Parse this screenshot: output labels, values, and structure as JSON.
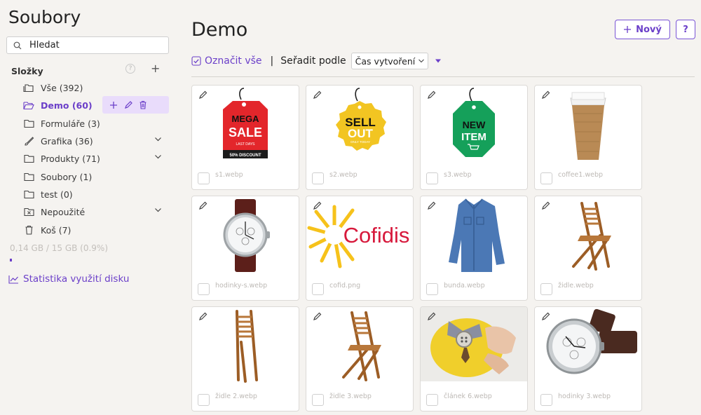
{
  "sidebar": {
    "title": "Soubory",
    "search_placeholder": "Hledat",
    "folders_label": "Složky",
    "help_symbol": "?",
    "add_symbol": "+",
    "items": [
      {
        "label": "Vše (392)",
        "icon": "folders-icon"
      },
      {
        "label": "Demo (60)",
        "icon": "folder-open-icon",
        "active": true
      },
      {
        "label": "Formuláře (3)",
        "icon": "folder-icon"
      },
      {
        "label": "Grafika (36)",
        "icon": "brush-icon",
        "expandable": true
      },
      {
        "label": "Produkty (71)",
        "icon": "folder-icon",
        "expandable": true
      },
      {
        "label": "Soubory (1)",
        "icon": "folder-icon"
      },
      {
        "label": "test (0)",
        "icon": "folder-icon"
      },
      {
        "label": "Nepoužité",
        "icon": "unused-folder-icon",
        "expandable": true
      },
      {
        "label": "Koš (7)",
        "icon": "trash-icon"
      }
    ],
    "usage_text": "0,14 GB / 15 GB (0.9%)",
    "usage_fraction": 0.009,
    "stats_link": "Statistika využití disku"
  },
  "header": {
    "title": "Demo",
    "new_button": "Nový",
    "help_button": "?"
  },
  "toolbar": {
    "select_all": "Označit vše",
    "separator": "|",
    "sort_label": "Seřadit podle",
    "sort_value": "Čas vytvoření"
  },
  "files": [
    {
      "name": "s1.webp",
      "thumb": "mega-sale-tag"
    },
    {
      "name": "s2.webp",
      "thumb": "sell-out-badge"
    },
    {
      "name": "s3.webp",
      "thumb": "new-item-tag"
    },
    {
      "name": "coffee1.webp",
      "thumb": "coffee-cup"
    },
    {
      "name": "hodinky-s.webp",
      "thumb": "wristwatch"
    },
    {
      "name": "cofid.png",
      "thumb": "cofidis-logo"
    },
    {
      "name": "bunda.webp",
      "thumb": "denim-jacket"
    },
    {
      "name": "židle.webp",
      "thumb": "wooden-chair"
    },
    {
      "name": "židle 2.webp",
      "thumb": "folded-chair"
    },
    {
      "name": "židle 3.webp",
      "thumb": "wooden-chair"
    },
    {
      "name": "článek 6.webp",
      "thumb": "felt-crafting"
    },
    {
      "name": "hodinky 3.webp",
      "thumb": "wristwatch"
    }
  ],
  "thumb_text": {
    "mega_sale": [
      "MEGA",
      "SALE",
      "LAST DAYS",
      "50% DISCOUNT"
    ],
    "sell_out": [
      "SELL",
      "OUT",
      "ONLY TODAY"
    ],
    "new_item": [
      "NEW",
      "ITEM"
    ],
    "cofidis": "Cofidis"
  },
  "colors": {
    "accent": "#6b3fc9",
    "active_bg": "#e9dcfb",
    "page_bg": "#f5f3f0"
  }
}
